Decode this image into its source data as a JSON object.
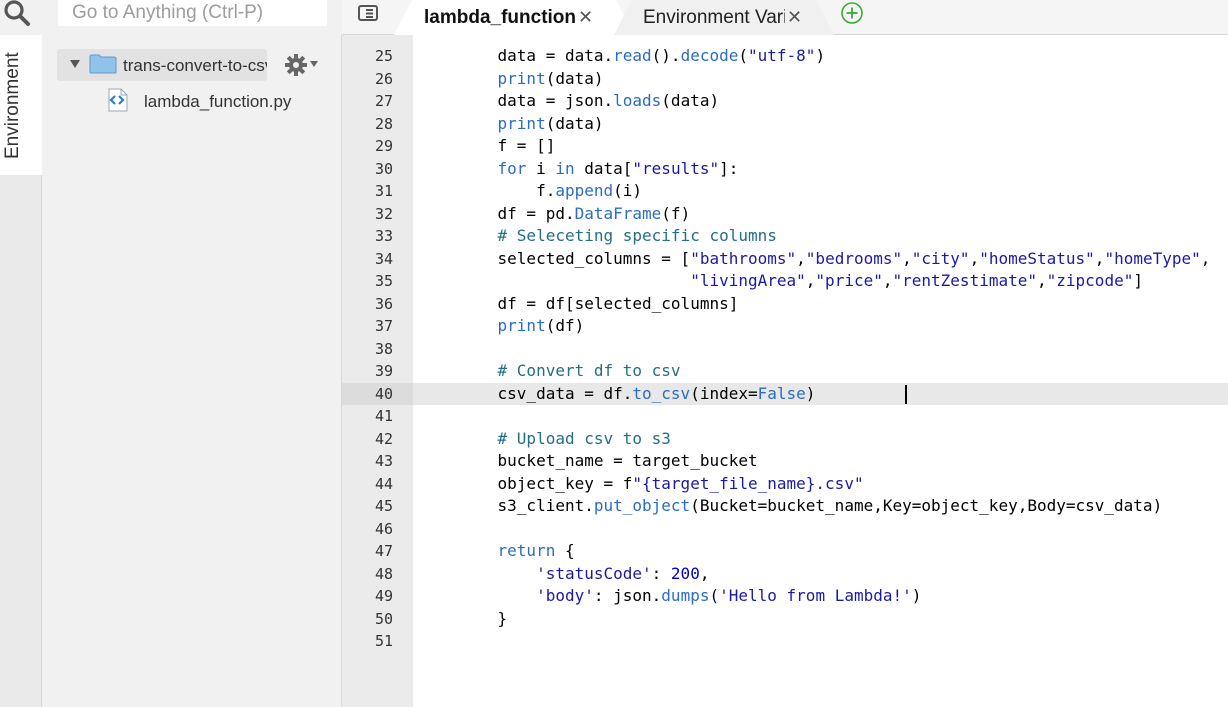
{
  "search": {
    "placeholder": "Go to Anything (Ctrl-P)"
  },
  "rail": {
    "environment_label": "Environment"
  },
  "tree": {
    "folder_label": "trans-convert-to-csv",
    "file_label": "lambda_function.py"
  },
  "tabs": [
    {
      "label": "lambda_function",
      "active": true
    },
    {
      "label": "Environment Variables",
      "active": false
    }
  ],
  "editor": {
    "active_line": 40,
    "lines": [
      {
        "n": "25",
        "code": "    data = data.read().decode(\"utf-8\")"
      },
      {
        "n": "26",
        "code": "    print(data)"
      },
      {
        "n": "27",
        "code": "    data = json.loads(data)"
      },
      {
        "n": "28",
        "code": "    print(data)"
      },
      {
        "n": "29",
        "code": "    f = []"
      },
      {
        "n": "30",
        "code": "    for i in data[\"results\"]:"
      },
      {
        "n": "31",
        "code": "        f.append(i)"
      },
      {
        "n": "32",
        "code": "    df = pd.DataFrame(f)"
      },
      {
        "n": "33",
        "code": "    # Seleceting specific columns"
      },
      {
        "n": "34",
        "code": "    selected_columns = [\"bathrooms\",\"bedrooms\",\"city\",\"homeStatus\",\"homeType\","
      },
      {
        "n": "35",
        "code": "                        \"livingArea\",\"price\",\"rentZestimate\",\"zipcode\"]"
      },
      {
        "n": "36",
        "code": "    df = df[selected_columns]"
      },
      {
        "n": "37",
        "code": "    print(df)"
      },
      {
        "n": "38",
        "code": ""
      },
      {
        "n": "39",
        "code": "    # Convert df to csv"
      },
      {
        "n": "40",
        "code": "    csv_data = df.to_csv(index=False)"
      },
      {
        "n": "41",
        "code": ""
      },
      {
        "n": "42",
        "code": "    # Upload csv to s3"
      },
      {
        "n": "43",
        "code": "    bucket_name = target_bucket"
      },
      {
        "n": "44",
        "code": "    object_key = f\"{target_file_name}.csv\""
      },
      {
        "n": "45",
        "code": "    s3_client.put_object(Bucket=bucket_name,Key=object_key,Body=csv_data)"
      },
      {
        "n": "46",
        "code": ""
      },
      {
        "n": "47",
        "code": "    return {"
      },
      {
        "n": "48",
        "code": "        'statusCode': 200,"
      },
      {
        "n": "49",
        "code": "        'body': json.dumps('Hello from Lambda!')"
      },
      {
        "n": "50",
        "code": "    }"
      },
      {
        "n": "51",
        "code": ""
      }
    ]
  },
  "colors": {
    "keyword": "#2b6cc4",
    "string": "#1a1aa6",
    "comment": "#236e88",
    "number": "#0000cd",
    "accent_green": "#3aaa35",
    "folder_blue": "#8fc3ea"
  }
}
